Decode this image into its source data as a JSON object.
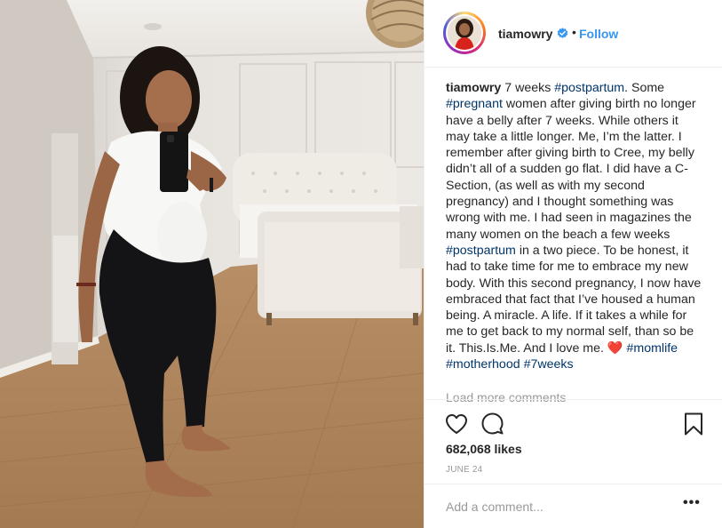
{
  "post": {
    "username": "tiamowry",
    "follow_label": "Follow",
    "separator": "•",
    "caption_parts": [
      {
        "t": "text",
        "v": " 7 weeks "
      },
      {
        "t": "tag",
        "v": "#postpartum"
      },
      {
        "t": "text",
        "v": ". Some "
      },
      {
        "t": "tag",
        "v": "#pregnant"
      },
      {
        "t": "text",
        "v": " women after giving birth no longer have a belly after 7 weeks. While others it may take a little longer. Me, I’m the latter. I remember after giving birth to Cree, my belly didn’t all of a sudden go flat. I did have a C-Section, (as well as with my second pregnancy) and I thought something was wrong with me. I had seen in magazines the many women on the beach a few weeks "
      },
      {
        "t": "tag",
        "v": "#postpartum"
      },
      {
        "t": "text",
        "v": " in a two piece. To be honest, it had to take time for me to embrace my new body. With this second pregnancy, I now have embraced that fact that I’ve housed a human being. A miracle. A life. If it takes a while for me to get back to my normal self, than so be it. This.Is.Me. And I love me. "
      },
      {
        "t": "heart",
        "v": "❤️"
      },
      {
        "t": "text",
        "v": " "
      },
      {
        "t": "tag",
        "v": "#momlife"
      },
      {
        "t": "text",
        "v": " "
      },
      {
        "t": "tag",
        "v": "#motherhood"
      },
      {
        "t": "text",
        "v": " "
      },
      {
        "t": "tag",
        "v": "#7weeks"
      }
    ],
    "load_more_label": "Load more comments",
    "likes_text": "682,068 likes",
    "date_text": "JUNE 24",
    "comment_placeholder": "Add a comment...",
    "more_label": "•••"
  },
  "icons": {
    "verified": "verified-badge-icon",
    "like": "heart-icon",
    "comment": "comment-bubble-icon",
    "save": "bookmark-icon",
    "more": "more-options-icon"
  },
  "colors": {
    "link": "#3897f0",
    "hashtag": "#003569",
    "muted": "#999999",
    "heart": "#ed4956"
  }
}
